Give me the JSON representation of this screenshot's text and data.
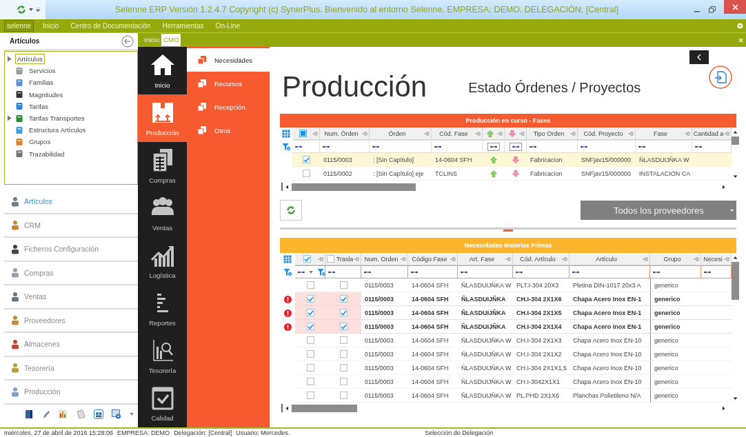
{
  "window": {
    "title": "Selenne ERP Versión 1.2.4.7 Copyright (c) SynerPlus. Bienvenido al entorno Selenne. EMPRESA: DEMO. DELEGACIÓN: [Central]"
  },
  "menu": [
    {
      "label": "selenne",
      "selected": true
    },
    {
      "label": "Inicio",
      "selected": false
    },
    {
      "label": "Centro de Documentación",
      "selected": false
    },
    {
      "label": "Herramientas",
      "selected": false
    },
    {
      "label": "On-Line",
      "selected": false
    }
  ],
  "left_panel": {
    "title": "Artículos",
    "tree": [
      {
        "label": "Artículos",
        "expandable": true,
        "selected": true
      },
      {
        "label": "Servicios",
        "expandable": false,
        "selected": false
      },
      {
        "label": "Familias",
        "expandable": false,
        "selected": false
      },
      {
        "label": "Magnitudes",
        "expandable": false,
        "selected": false
      },
      {
        "label": "Tarifas",
        "expandable": false,
        "selected": false
      },
      {
        "label": "Tarifas Transportes",
        "expandable": true,
        "selected": false
      },
      {
        "label": "Estructura Artículos",
        "expandable": false,
        "selected": false
      },
      {
        "label": "Grupos",
        "expandable": false,
        "selected": false
      },
      {
        "label": "Trazabilidad",
        "expandable": false,
        "selected": false
      }
    ],
    "nav": [
      {
        "label": "Artículos",
        "selected": true
      },
      {
        "label": "CRM",
        "selected": false
      },
      {
        "label": "Ficheros Configuración",
        "selected": false
      },
      {
        "label": "Compras",
        "selected": false
      },
      {
        "label": "Ventas",
        "selected": false
      },
      {
        "label": "Proveedores",
        "selected": false
      },
      {
        "label": "Almacenes",
        "selected": false
      },
      {
        "label": "Tesorería",
        "selected": false
      },
      {
        "label": "Producción",
        "selected": false
      }
    ]
  },
  "tabs": [
    {
      "label": "Inicio",
      "selected": false
    },
    {
      "label": "CMO",
      "selected": true
    }
  ],
  "modules": [
    {
      "label": "Inicio",
      "selected": false
    },
    {
      "label": "Producción",
      "selected": true
    },
    {
      "label": "Compras",
      "selected": false
    },
    {
      "label": "Ventas",
      "selected": false
    },
    {
      "label": "Logística",
      "selected": false
    },
    {
      "label": "Reportes",
      "selected": false
    },
    {
      "label": "Tesorería",
      "selected": false
    },
    {
      "label": "Calidad",
      "selected": false
    }
  ],
  "submenu": [
    {
      "label": "Necesidades",
      "selected": true
    },
    {
      "label": "Recursos",
      "selected": false
    },
    {
      "label": "Recepción",
      "selected": false
    },
    {
      "label": "Otros",
      "selected": false
    }
  ],
  "content": {
    "title": "Producción",
    "subtitle": "Estado Órdenes / Proyectos"
  },
  "grid1": {
    "title": "Producción en curso - Fases",
    "columns": [
      {
        "kind": "check",
        "checked": false,
        "indeterminate": true
      },
      {
        "kind": "text",
        "label": "Num. Órden"
      },
      {
        "kind": "text",
        "label": "Órden"
      },
      {
        "kind": "text",
        "label": "Cód. Fase"
      },
      {
        "kind": "up"
      },
      {
        "kind": "down"
      },
      {
        "kind": "text",
        "label": "Tipo Orden"
      },
      {
        "kind": "text",
        "label": "Cód. Proyecto"
      },
      {
        "kind": "text",
        "label": "Fase"
      },
      {
        "kind": "text",
        "label": "Cantidad a"
      }
    ],
    "rows": [
      {
        "selected": true,
        "checked": true,
        "cells": [
          "",
          "0115/0003",
          ": [Sin Capítulo]",
          "14-0604 SFH",
          "",
          "",
          "Fabricacion",
          "SNFjav15/000000",
          "ÑLASDUIJÑKA W",
          ""
        ]
      },
      {
        "selected": false,
        "checked": false,
        "cells": [
          "",
          "0115/0002",
          ": [Sin Capítulo] eje",
          "TCLINS",
          "",
          "",
          "Fabricacion",
          "SNFjav15/000000",
          "INSTALACION CA",
          ""
        ]
      }
    ]
  },
  "supplier_filter": {
    "value": "Todos los proveedores"
  },
  "grid2": {
    "title": "Necesidades Materias Primas",
    "columns": [
      {
        "kind": "check",
        "checked": true
      },
      {
        "kind": "check_text",
        "label": "Trasla",
        "checked": false
      },
      {
        "kind": "text",
        "label": "Num. Orden"
      },
      {
        "kind": "text",
        "label": "Código Fase"
      },
      {
        "kind": "text",
        "label": "Art. Fase"
      },
      {
        "kind": "text",
        "label": "Cód. Artículo"
      },
      {
        "kind": "text",
        "label": "Artículo"
      },
      {
        "kind": "text",
        "label": "Grupo"
      },
      {
        "kind": "text",
        "label": "Necesi"
      }
    ],
    "rows": [
      {
        "alert": false,
        "selected": false,
        "checked": false,
        "trasla": false,
        "cells": [
          "",
          "",
          "0115/0003",
          "14-0604 SFH",
          "ÑLASDUIJÑKA W",
          "PLT.I-304 20X3",
          "Pletina DIN-1017 20x3 A",
          "generico",
          ""
        ]
      },
      {
        "alert": true,
        "selected": true,
        "checked": true,
        "trasla": true,
        "cells": [
          "",
          "",
          "0115/0003",
          "14-0604 SFH",
          "ÑLASDUIJÑKA",
          "CH.I-304 2X1X6",
          "Chapa Acero Inox EN-1",
          "generico",
          ""
        ]
      },
      {
        "alert": true,
        "selected": true,
        "checked": true,
        "trasla": true,
        "cells": [
          "",
          "",
          "0115/0003",
          "14-0604 SFH",
          "ÑLASDUIJÑKA",
          "CH.I-304 2X1X5",
          "Chapa Acero Inox EN-1",
          "generico",
          ""
        ]
      },
      {
        "alert": true,
        "selected": true,
        "checked": true,
        "trasla": true,
        "cells": [
          "",
          "",
          "0115/0003",
          "14-0604 SFH",
          "ÑLASDUIJÑKA",
          "CH.I-304 2X1X4",
          "Chapa Acero Inox EN-1",
          "generico",
          ""
        ]
      },
      {
        "alert": false,
        "selected": false,
        "checked": false,
        "trasla": false,
        "cells": [
          "",
          "",
          "0115/0003",
          "14-0604 SFH",
          "ÑLASDUIJÑKA W",
          "CH.I-304 2X1X3",
          "Chapa Acero Inox EN-10",
          "generico",
          ""
        ]
      },
      {
        "alert": false,
        "selected": false,
        "checked": false,
        "trasla": false,
        "cells": [
          "",
          "",
          "0115/0003",
          "14-0604 SFH",
          "ÑLASDUIJÑKA W",
          "CH.I-304 2X1X2",
          "Chapa Acero Inox EN-10",
          "generico",
          ""
        ]
      },
      {
        "alert": false,
        "selected": false,
        "checked": false,
        "trasla": false,
        "cells": [
          "",
          "",
          "0115/0003",
          "14-0604 SFH",
          "ÑLASDUIJÑKA W",
          "CH.I-304 2X1X1,5",
          "Chapa Acero Inox EN-10",
          "generico",
          ""
        ]
      },
      {
        "alert": false,
        "selected": false,
        "checked": false,
        "trasla": false,
        "cells": [
          "",
          "",
          "0115/0003",
          "14-0604 SFH",
          "ÑLASDUIJÑKA W",
          "CH.I-3042X1X1",
          "Chapa Acero Inox EN-10",
          "generico",
          ""
        ]
      },
      {
        "alert": false,
        "selected": false,
        "checked": false,
        "trasla": false,
        "cells": [
          "",
          "",
          "0115/0003",
          "14-0604 SFH",
          "ÑLASDUIJÑKA W",
          "PL.PHD 2X1X6",
          "Planchas Polietileno N/A",
          "generico",
          ""
        ]
      }
    ]
  },
  "status_bar": {
    "date": "miércoles, 27 de abril de 2016 15:28:06",
    "company": "EMPRESA: DEMO",
    "delegation": "Delegación: [Central]",
    "user": "Usuario: Mercedes.",
    "action": "Selección de Delegación"
  }
}
